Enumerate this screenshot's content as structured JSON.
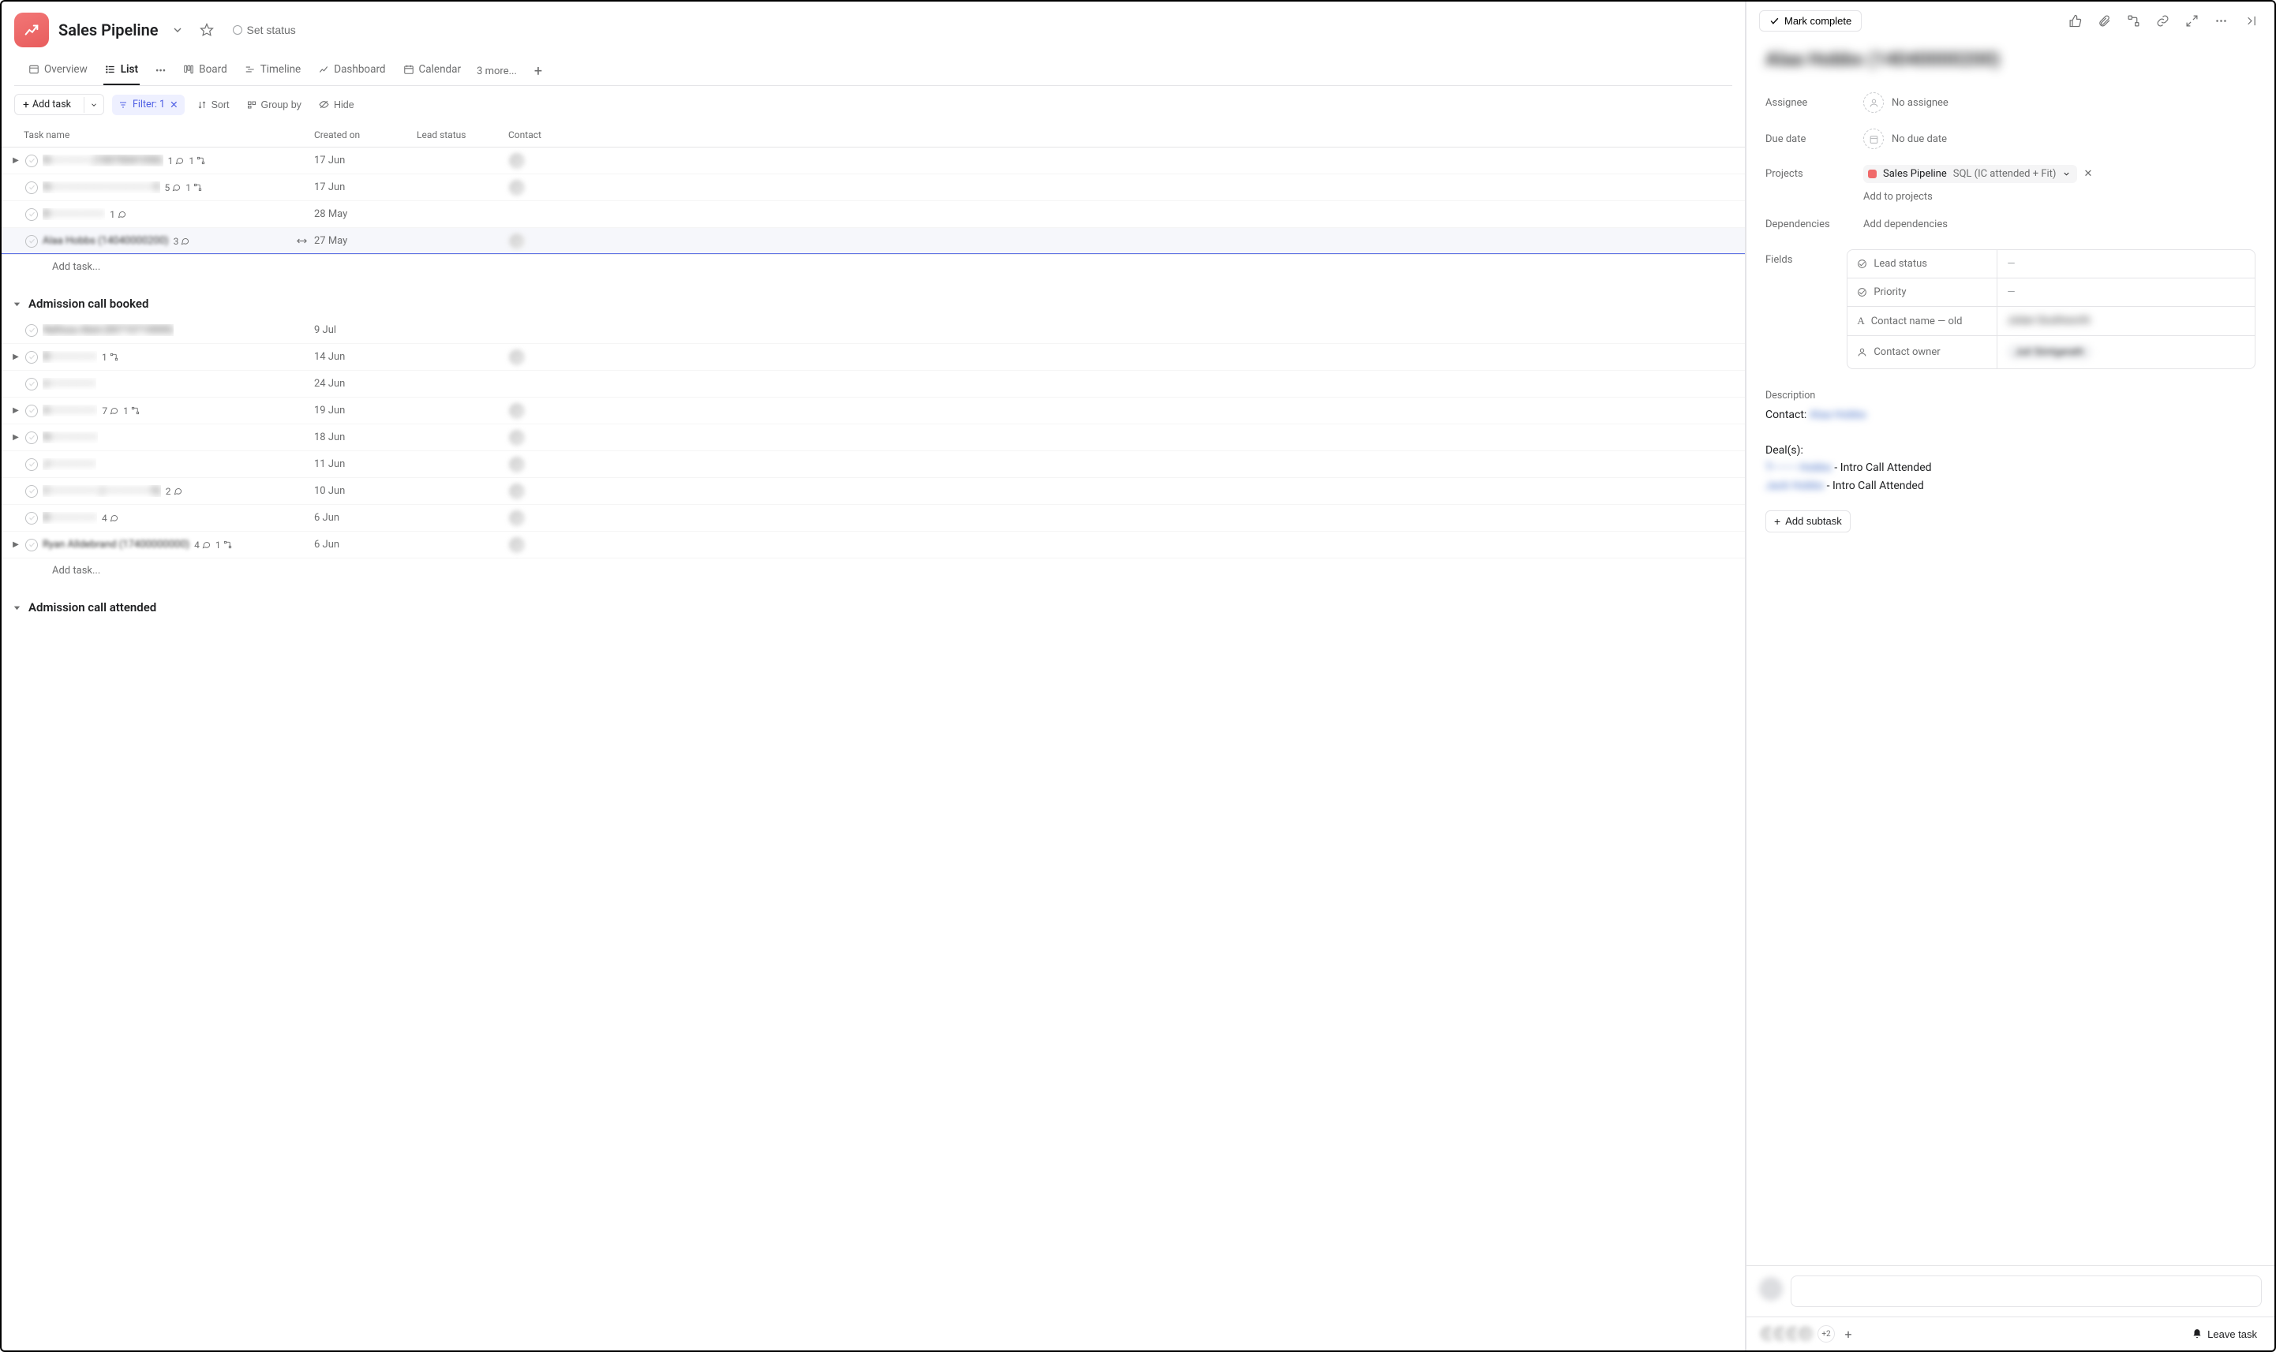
{
  "header": {
    "project_name": "Sales Pipeline",
    "set_status": "Set status"
  },
  "tabs": {
    "overview": "Overview",
    "list": "List",
    "board": "Board",
    "timeline": "Timeline",
    "dashboard": "Dashboard",
    "calendar": "Calendar",
    "more": "3 more..."
  },
  "toolbar": {
    "add_task": "Add task",
    "filter": "Filter: 1",
    "sort": "Sort",
    "group_by": "Group by",
    "hide": "Hide"
  },
  "columns": {
    "task_name": "Task name",
    "created_on": "Created on",
    "lead_status": "Lead status",
    "contact": "Contact"
  },
  "section1": {
    "rows": [
      {
        "name_redacted": "N————— (10070041050)",
        "comments": "1",
        "subtasks": "1",
        "has_expand": true,
        "created": "17 Jun",
        "has_contact": true
      },
      {
        "name_redacted": "N—————————————5",
        "comments": "5",
        "subtasks": "1",
        "has_expand": false,
        "created": "17 Jun",
        "has_contact": true
      },
      {
        "name_redacted": "B———————",
        "comments": "1",
        "subtasks": "",
        "has_expand": false,
        "created": "28 May",
        "has_contact": false
      },
      {
        "name_visible": "Alaa Hobbs (14040000200)",
        "comments": "3",
        "subtasks": "",
        "has_expand": false,
        "created": "27 May",
        "has_contact": true,
        "selected": true
      }
    ],
    "add_task": "Add task..."
  },
  "section2": {
    "title": "Admission call booked",
    "rows": [
      {
        "name_redacted": "Nafissa Abid (00710710000)",
        "created": "9 Jul",
        "has_contact": false
      },
      {
        "name_redacted": "B——————",
        "subtasks": "1",
        "has_expand": true,
        "created": "14 Jun",
        "has_contact": true
      },
      {
        "name_redacted": "n——————",
        "comments": "",
        "created": "24 Jun",
        "has_contact": false
      },
      {
        "name_redacted": "A——————",
        "comments": "7",
        "subtasks": "1",
        "has_expand": true,
        "created": "19 Jun",
        "has_contact": true
      },
      {
        "name_redacted": "N——————",
        "has_expand": true,
        "created": "18 Jun",
        "has_contact": true
      },
      {
        "name_redacted": "J——————",
        "created": "11 Jun",
        "has_contact": true
      },
      {
        "name_redacted": "C—————— (——————5)",
        "comments": "2",
        "created": "10 Jun",
        "has_contact": true
      },
      {
        "name_redacted": "B——————",
        "comments": "4",
        "created": "6 Jun",
        "has_contact": true
      },
      {
        "name_visible": "Ryan Alldebrand (17400000000)",
        "comments": "4",
        "subtasks": "1",
        "has_expand": true,
        "created": "6 Jun",
        "has_contact": true
      }
    ],
    "add_task": "Add task..."
  },
  "section3": {
    "title": "Admission call attended"
  },
  "detail": {
    "mark_complete": "Mark complete",
    "title_redacted": "Alaa Hobbs (14040000200)",
    "labels": {
      "assignee": "Assignee",
      "due_date": "Due date",
      "projects": "Projects",
      "dependencies": "Dependencies",
      "fields": "Fields",
      "description": "Description"
    },
    "no_assignee": "No assignee",
    "no_due_date": "No due date",
    "project_name": "Sales Pipeline",
    "project_stage": "SQL (IC attended + Fit)",
    "add_to_projects": "Add to projects",
    "add_dependencies": "Add dependencies",
    "fields_table": {
      "lead_status": {
        "label": "Lead status",
        "value": "—"
      },
      "priority": {
        "label": "Priority",
        "value": "—"
      },
      "contact_name_old": {
        "label": "Contact name — old",
        "value_redacted": "Julian Southworth"
      },
      "contact_owner": {
        "label": "Contact owner",
        "value_redacted": "Juli Söntgerath"
      }
    },
    "description": {
      "contact_prefix": "Contact: ",
      "contact_name_redacted": "Alaa Hobbs",
      "deals_label": "Deal(s):",
      "deal1_name_redacted": "T——— Hobbs",
      "deal1_suffix": " - Intro Call Attended",
      "deal2_name_redacted": "Jack Hobbs",
      "deal2_suffix": " - Intro Call Attended"
    },
    "add_subtask": "Add subtask",
    "collab_extra": "+2",
    "leave_task": "Leave task"
  }
}
